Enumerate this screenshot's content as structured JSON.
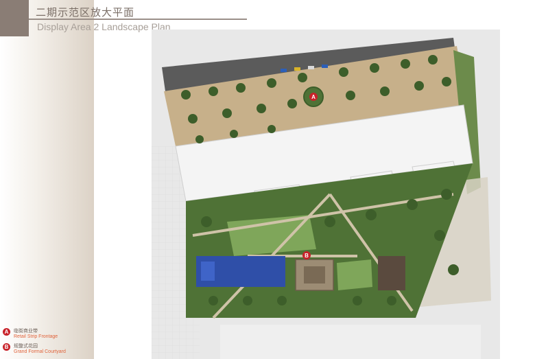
{
  "header": {
    "title_cn": "二期示范区放大平面",
    "title_en": "Display Area 2 Landscape Plan"
  },
  "plan": {
    "markers": [
      {
        "letter": "A"
      },
      {
        "letter": "B"
      }
    ]
  },
  "legend": {
    "items": [
      {
        "letter": "A",
        "label_cn": "临街商业带",
        "label_en": "Retail Strip Frontage"
      },
      {
        "letter": "B",
        "label_cn": "规整式花园",
        "label_en": "Grand Formal Courtyard"
      }
    ]
  },
  "colors": {
    "accent_red": "#c8222a",
    "legend_en_text": "#e0623a",
    "title_bar": "#8a7d75",
    "pool_blue": "#2f4fa8"
  }
}
